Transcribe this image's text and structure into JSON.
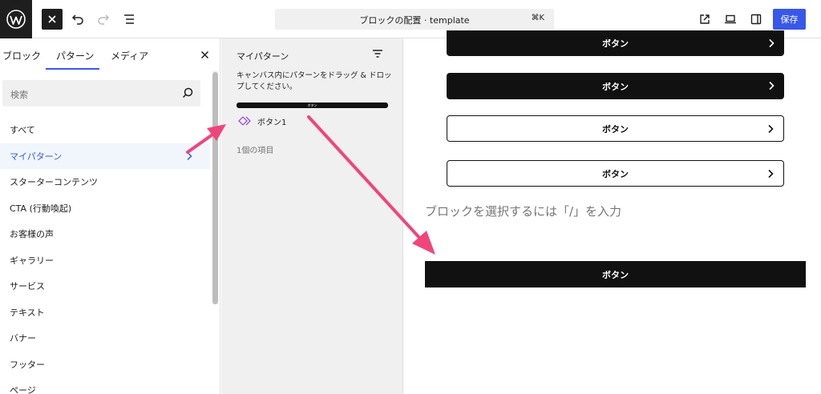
{
  "topbar": {
    "command_title": "ブロックの配置 · template",
    "command_shortcut": "⌘K",
    "save_label": "保存"
  },
  "inserter": {
    "tabs": [
      "ブロック",
      "パターン",
      "メディア"
    ],
    "search_placeholder": "検索",
    "categories": [
      "すべて",
      "マイパターン",
      "スターターコンテンツ",
      "CTA (行動喚起)",
      "お客様の声",
      "ギャラリー",
      "サービス",
      "テキスト",
      "バナー",
      "フッター",
      "ページ"
    ],
    "active_category": "マイパターン"
  },
  "patterns_panel": {
    "title": "マイパターン",
    "description": "キャンバス内にパターンをドラッグ & ドロップしてください。",
    "preview_text": "ボタン",
    "item_label": "ボタン1",
    "count": "1個の項目"
  },
  "canvas": {
    "button_label": "ボタン",
    "placeholder": "ブロックを選択するには「/」を入力",
    "inserted_button_label": "ボタン"
  },
  "colors": {
    "accent": "#3858e9",
    "arrow": "#f0457c",
    "button_dark": "#111111"
  }
}
